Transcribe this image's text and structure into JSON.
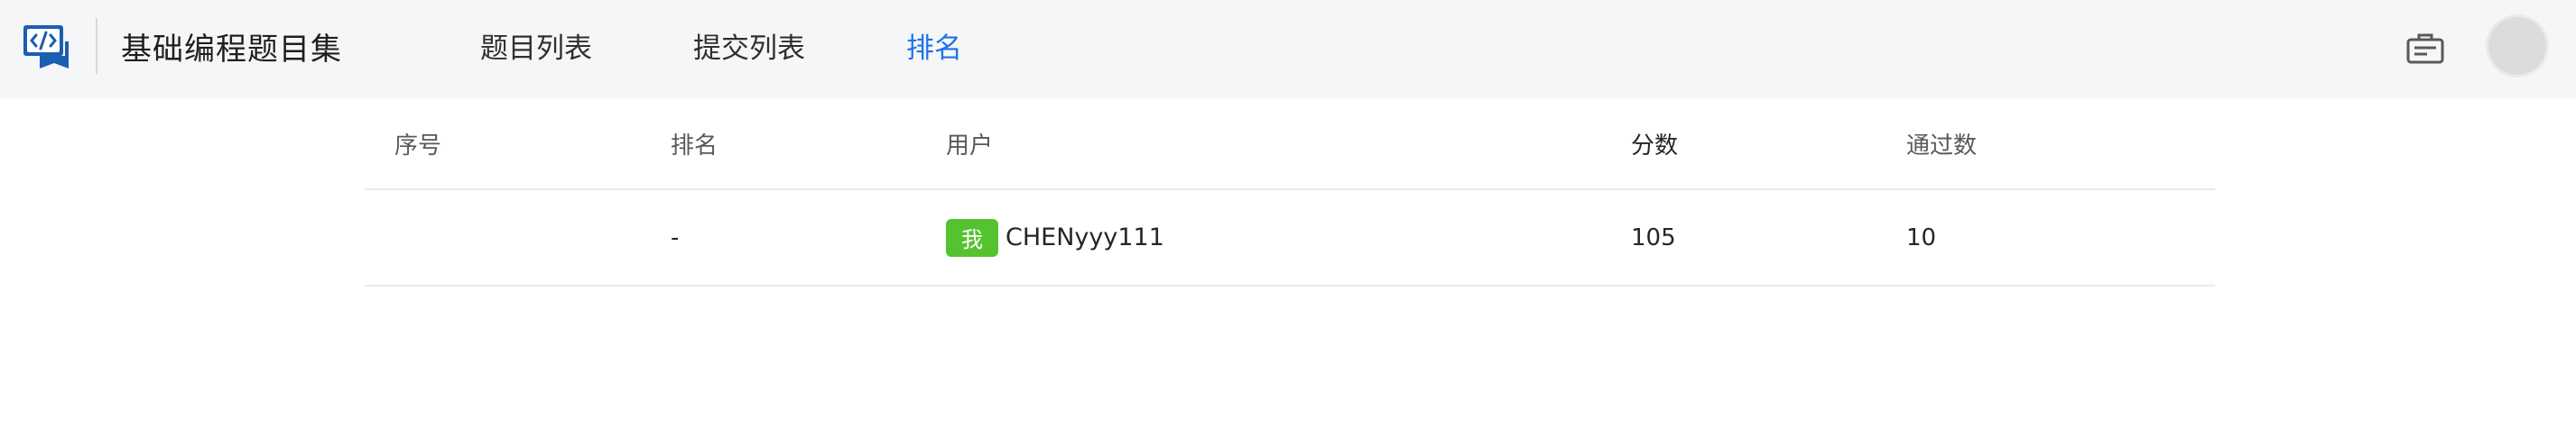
{
  "header": {
    "title": "基础编程题目集",
    "logo_icon": "code-book-icon",
    "nav": [
      {
        "label": "题目列表",
        "active": false
      },
      {
        "label": "提交列表",
        "active": false
      },
      {
        "label": "排名",
        "active": true
      }
    ],
    "message_icon": "inbox-icon",
    "accent_color": "#1e73e8"
  },
  "table": {
    "columns": [
      "序号",
      "排名",
      "用户",
      "分数",
      "通过数"
    ],
    "rows": [
      {
        "index": "",
        "rank": "-",
        "badge": "我",
        "user": "CHENyyy111",
        "score": "105",
        "passed": "10"
      }
    ],
    "badge_color": "#55c22f"
  }
}
